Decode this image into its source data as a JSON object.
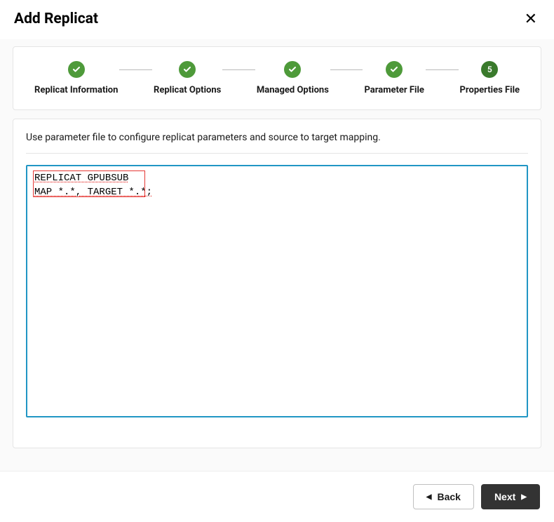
{
  "header": {
    "title": "Add Replicat"
  },
  "stepper": {
    "steps": [
      {
        "label": "Replicat Information",
        "status": "completed"
      },
      {
        "label": "Replicat Options",
        "status": "completed"
      },
      {
        "label": "Managed Options",
        "status": "completed"
      },
      {
        "label": "Parameter File",
        "status": "completed"
      },
      {
        "label": "Properties File",
        "status": "current",
        "number": "5"
      }
    ]
  },
  "paramCard": {
    "description": "Use parameter file to configure replicat parameters and source to target mapping.",
    "codeLine1": "REPLICAT GPUBSUB",
    "codeLine2": "MAP *.*, TARGET *.*;"
  },
  "footer": {
    "back": "Back",
    "next": "Next"
  },
  "colors": {
    "stepperGreen": "#4e9a3a",
    "stepperCurrentGreen": "#3a7a2c",
    "editorBorder": "#2196c4",
    "highlightRed": "#e53935",
    "nextBtn": "#333333"
  }
}
